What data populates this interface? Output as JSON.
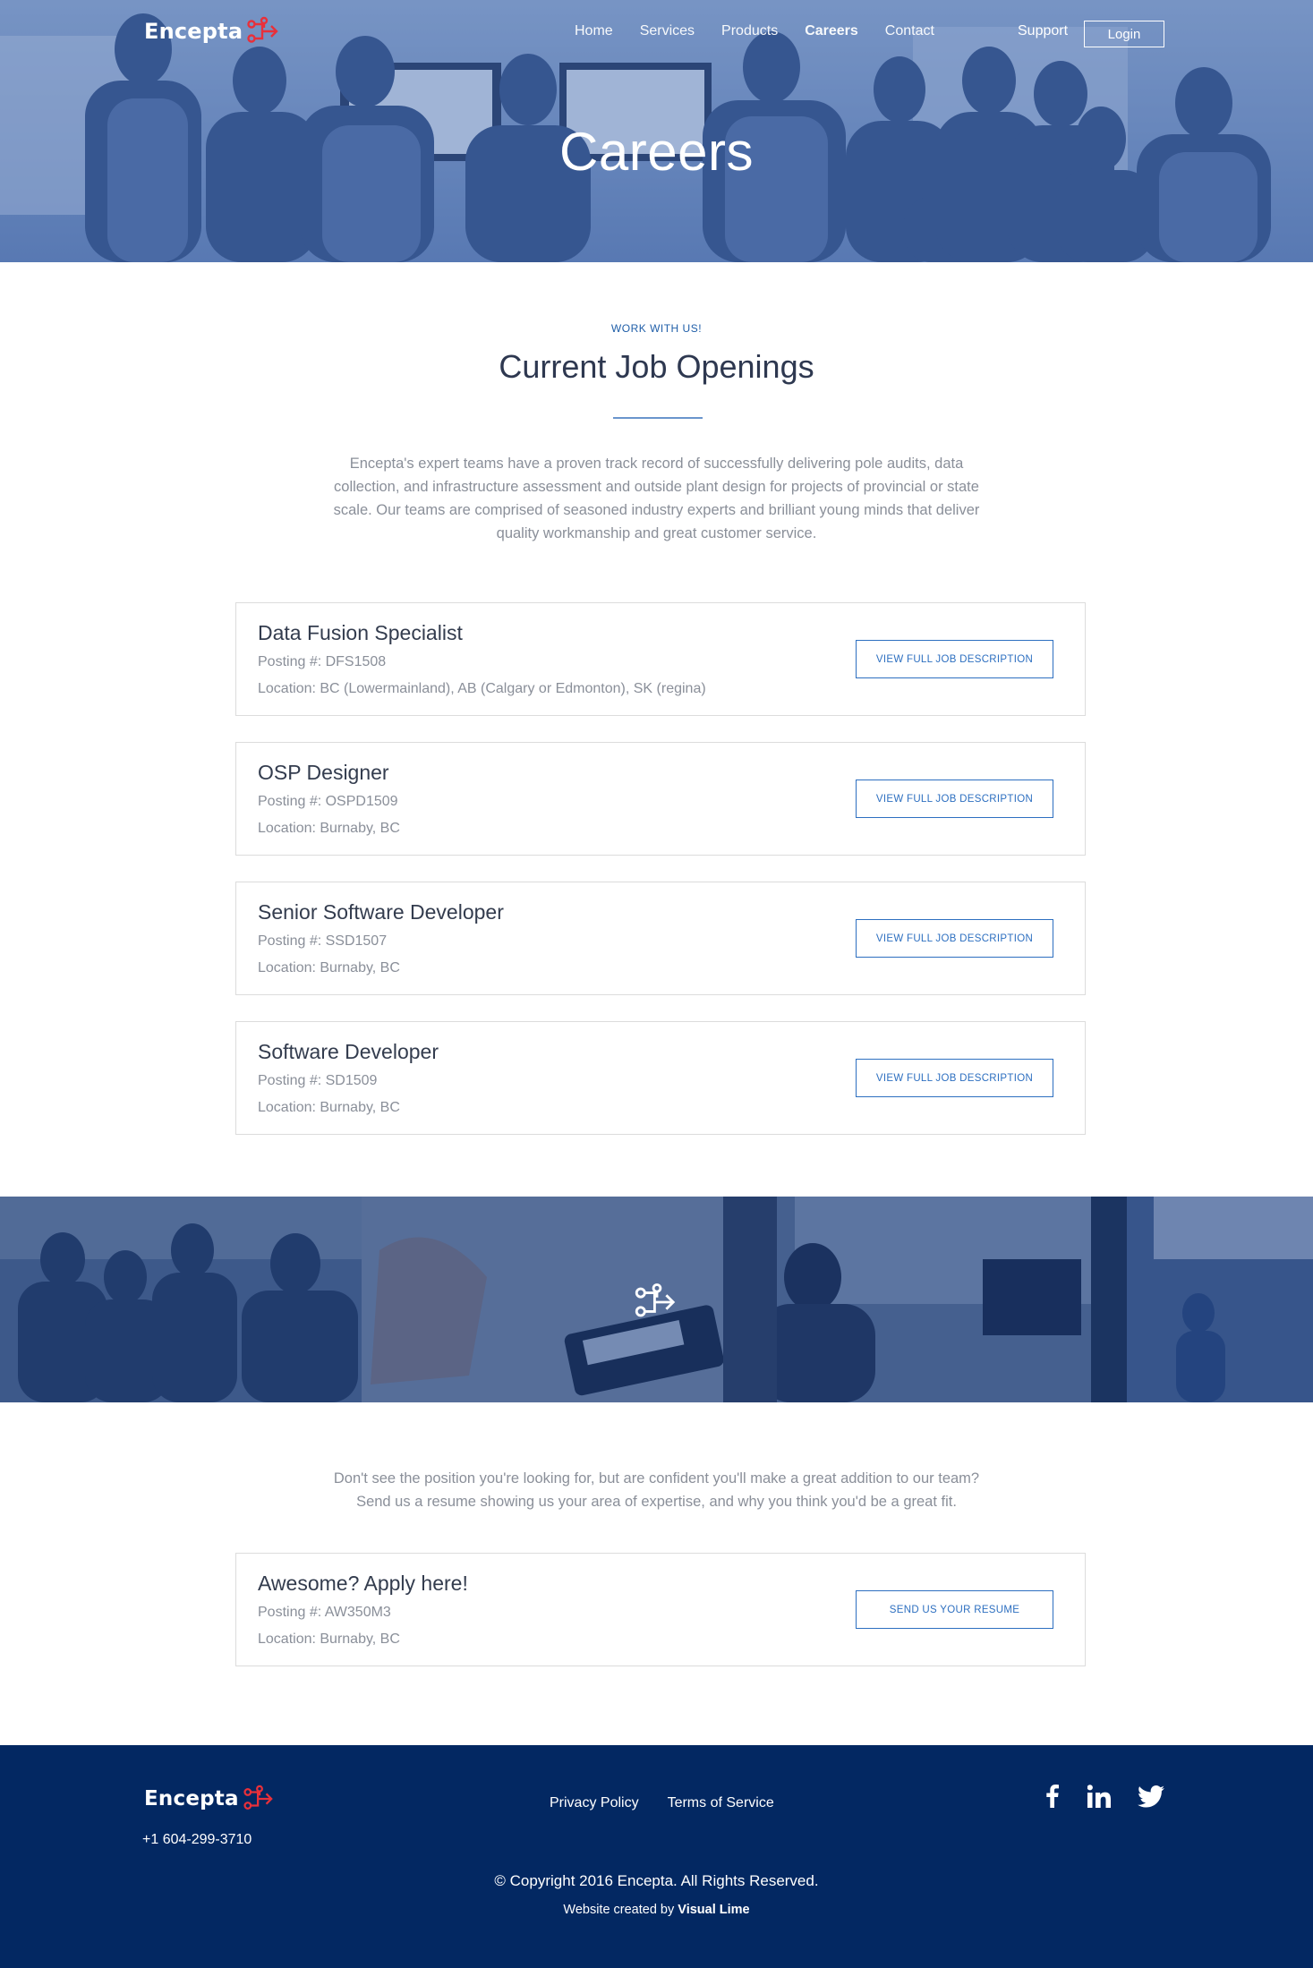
{
  "header": {
    "logo_text": "Encepta",
    "nav": [
      {
        "label": "Home",
        "active": false
      },
      {
        "label": "Services",
        "active": false
      },
      {
        "label": "Products",
        "active": false
      },
      {
        "label": "Careers",
        "active": true
      },
      {
        "label": "Contact",
        "active": false
      }
    ],
    "support_label": "Support",
    "login_label": "Login"
  },
  "hero": {
    "title": "Careers"
  },
  "intro": {
    "eyebrow": "WORK WITH US!",
    "title": "Current Job Openings",
    "body": "Encepta's expert teams have a proven track record of successfully delivering pole audits, data collection, and infrastructure assessment and outside plant design for projects of provincial or state scale. Our teams are comprised of seasoned industry experts and brilliant young minds that deliver quality workmanship and great customer service."
  },
  "jobs": [
    {
      "title": "Data Fusion Specialist",
      "posting": "Posting #: DFS1508",
      "location": "Location: BC (Lowermainland), AB (Calgary or Edmonton), SK (regina)",
      "button": "VIEW FULL JOB DESCRIPTION"
    },
    {
      "title": "OSP Designer",
      "posting": "Posting #: OSPD1509",
      "location": "Location: Burnaby, BC",
      "button": "VIEW FULL JOB DESCRIPTION"
    },
    {
      "title": "Senior Software Developer",
      "posting": "Posting #: SSD1507",
      "location": "Location: Burnaby, BC",
      "button": "VIEW FULL JOB DESCRIPTION"
    },
    {
      "title": "Software Developer",
      "posting": "Posting #: SD1509",
      "location": "Location: Burnaby, BC",
      "button": "VIEW FULL JOB DESCRIPTION"
    }
  ],
  "cta": {
    "line1": "Don't see the position you're looking for, but are confident you'll make a great addition to our team?",
    "line2": "Send us a resume showing us your area of expertise, and why you think you'd be a great fit.",
    "card": {
      "title": "Awesome? Apply here!",
      "posting": "Posting #: AW350M3",
      "location": "Location: Burnaby, BC",
      "button": "SEND US YOUR RESUME"
    }
  },
  "footer": {
    "logo_text": "Encepta",
    "phone": "+1 604-299-3710",
    "links": [
      "Privacy Policy",
      "Terms of Service"
    ],
    "social": [
      "facebook-icon",
      "linkedin-icon",
      "twitter-icon"
    ],
    "copyright": "© Copyright 2016 Encepta. All Rights Reserved.",
    "credit_prefix": "Website created by",
    "credit_name": "Visual Lime"
  },
  "colors": {
    "accent": "#2d6fc0",
    "footer_bg": "#032862",
    "logo_mark": "#e8303a",
    "heading": "#2e3850"
  }
}
